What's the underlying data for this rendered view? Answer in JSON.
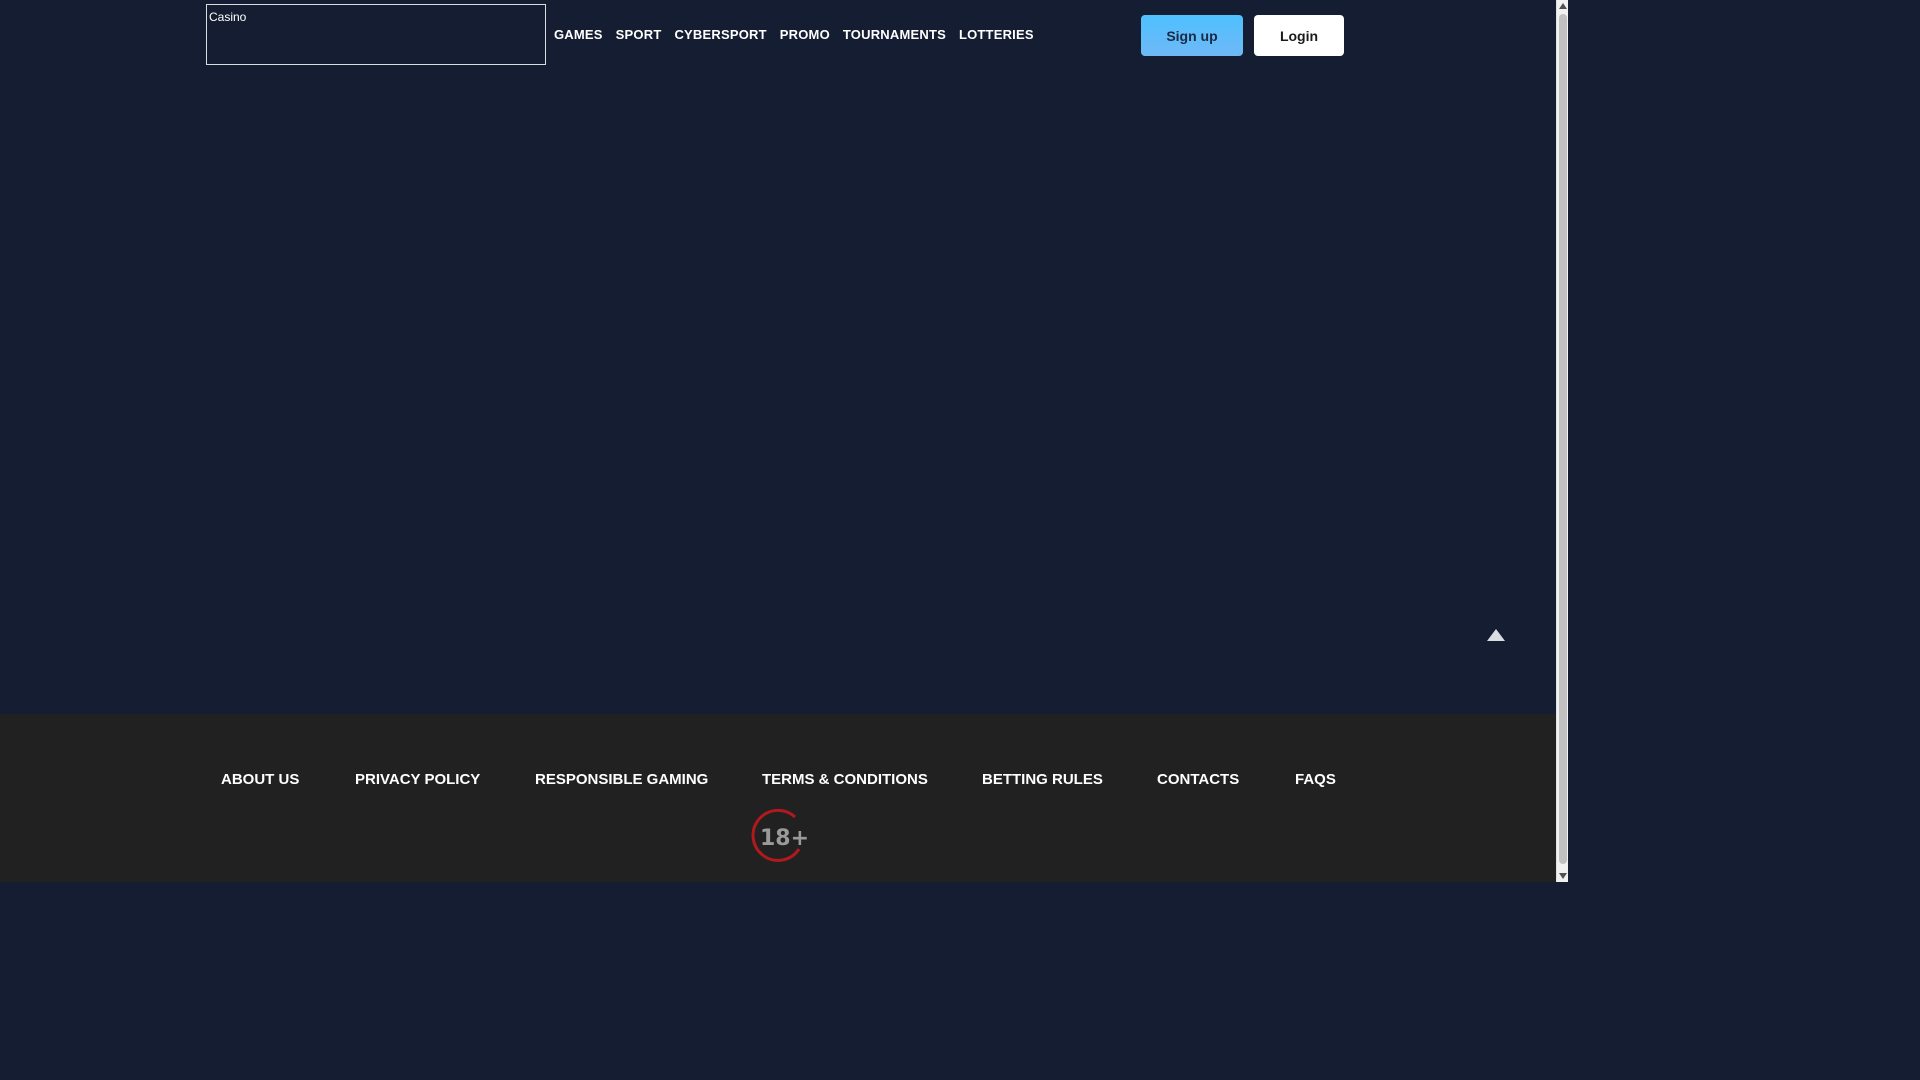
{
  "header": {
    "logo_alt": "Casino",
    "nav": [
      {
        "label": "GAMES"
      },
      {
        "label": "SPORT"
      },
      {
        "label": "CYBERSPORT"
      },
      {
        "label": "PROMO"
      },
      {
        "label": "TOURNAMENTS"
      },
      {
        "label": "LOTTERIES"
      }
    ],
    "signup_label": "Sign up",
    "login_label": "Login"
  },
  "footer": {
    "links": [
      {
        "label": "ABOUT US"
      },
      {
        "label": "PRIVACY POLICY"
      },
      {
        "label": "RESPONSIBLE GAMING"
      },
      {
        "label": "TERMS & CONDITIONS"
      },
      {
        "label": "BETTING RULES"
      },
      {
        "label": "CONTACTS"
      },
      {
        "label": "FAQS"
      }
    ],
    "age_badge": "18+"
  },
  "icons": {
    "scroll_top": "arrow-up-triangle-icon",
    "age": "age-restriction-18-icon"
  },
  "colors": {
    "page_bg": "#141d31",
    "footer_bg": "#212121",
    "signup_bg": "#4fc0ff",
    "login_bg": "#ffffff",
    "age_badge_ring": "#b0191e"
  }
}
